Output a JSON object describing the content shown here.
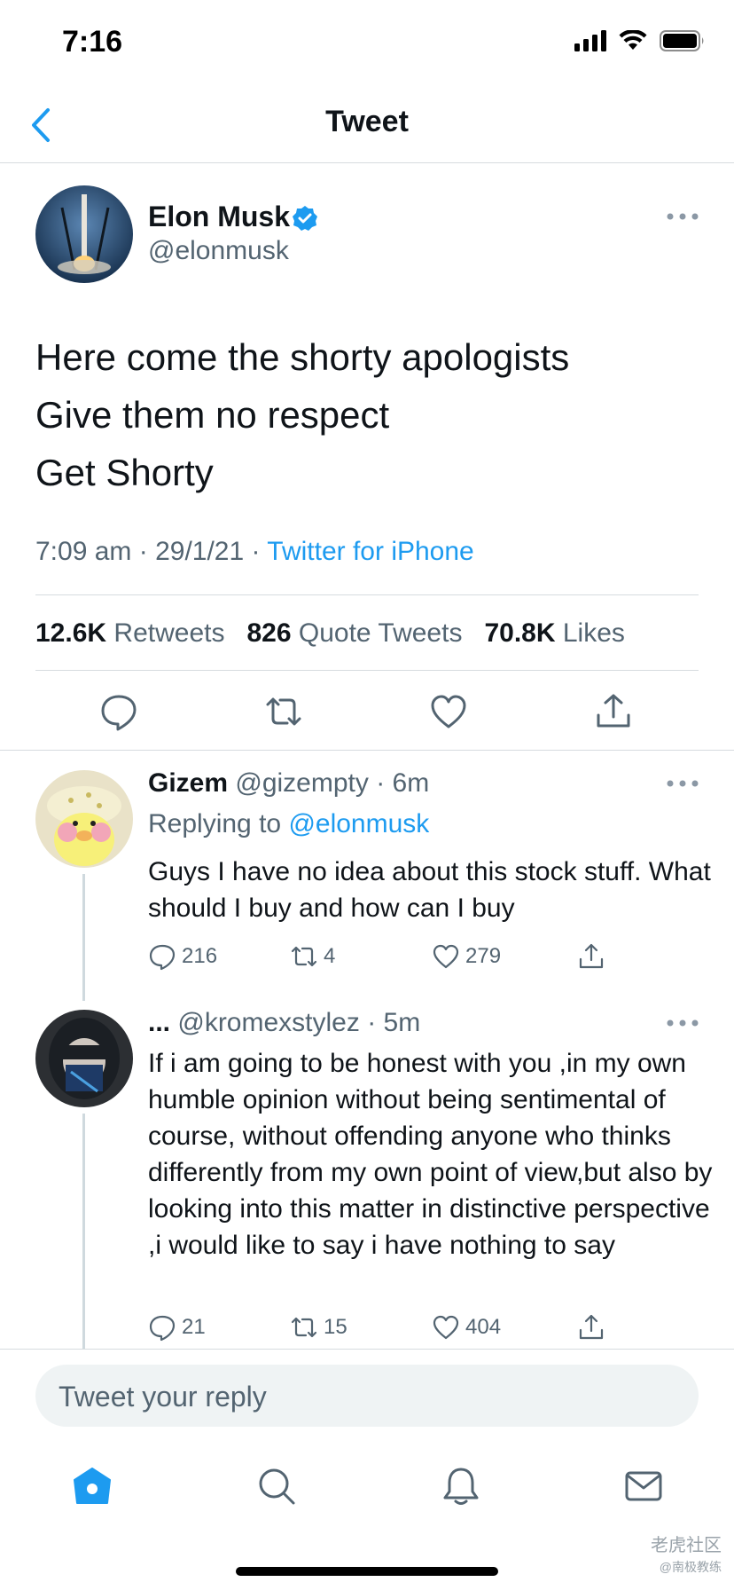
{
  "status_bar": {
    "time": "7:16"
  },
  "header": {
    "title": "Tweet"
  },
  "tweet": {
    "author_name": "Elon Musk",
    "author_handle": "@elonmusk",
    "lines": [
      "Here come the shorty apologists",
      "Give them no respect",
      "Get Shorty"
    ],
    "time": "7:09 am",
    "date": "29/1/21",
    "source": "Twitter for iPhone",
    "retweets_count": "12.6K",
    "retweets_label": "Retweets",
    "quotes_count": "826",
    "quotes_label": "Quote Tweets",
    "likes_count": "70.8K",
    "likes_label": "Likes"
  },
  "replies": [
    {
      "name": "Gizem",
      "handle": "@gizempty",
      "time": "6m",
      "replying_prefix": "Replying to",
      "replying_to": "@elonmusk",
      "text": "Guys I have no idea about this stock stuff. What should I buy and how can I buy",
      "reply_count": "216",
      "retweet_count": "4",
      "like_count": "279"
    },
    {
      "name": "...",
      "handle": "@kromexstylez",
      "time": "5m",
      "text": "If i am going to be honest with you ,in my own humble opinion without being sentimental of course, without offending anyone who thinks differently from my own point of view,but also by looking into this matter in distinctive perspective ,i would like to say i have nothing to say",
      "reply_count": "21",
      "retweet_count": "15",
      "like_count": "404"
    }
  ],
  "reply_input": {
    "placeholder": "Tweet your reply"
  },
  "tab_bar": {
    "icons": [
      "home-icon",
      "search-icon",
      "notifications-icon",
      "messages-icon"
    ]
  },
  "watermark": {
    "line1": "老虎社区",
    "line2": "@南极教练"
  },
  "colors": {
    "accent": "#1d9bf0",
    "text": "#0f1419",
    "secondary": "#536471",
    "divider": "#d6dbdf"
  }
}
